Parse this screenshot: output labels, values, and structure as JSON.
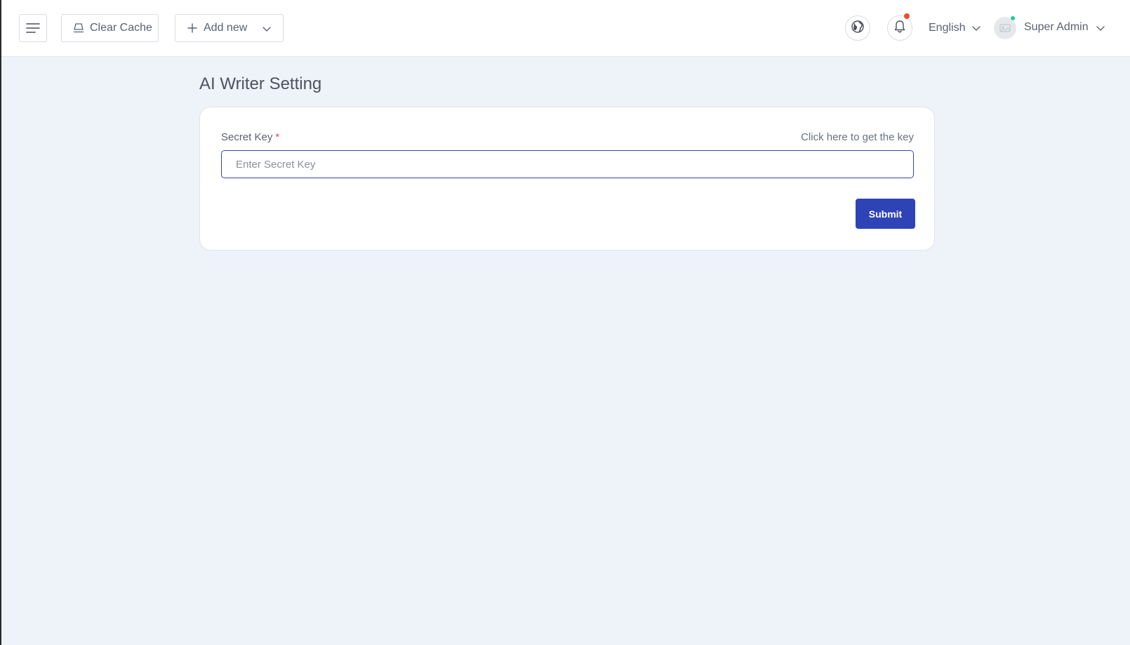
{
  "header": {
    "clear_cache_label": "Clear Cache",
    "add_new_label": "Add new",
    "language_label": "English",
    "user_name": "Super Admin",
    "icons": {
      "menu": "hamburger-menu-icon",
      "clear_cache": "broom-icon",
      "add": "plus-icon",
      "globe": "globe-icon",
      "notifications": "bell-icon",
      "dropdown": "chevron-down-icon",
      "avatar": "user-avatar-icon"
    },
    "notification_dot_color": "#f04b2f",
    "online_dot_color": "#22c79b"
  },
  "main": {
    "page_title": "AI Writer Setting",
    "form": {
      "secret_key_label": "Secret Key",
      "required_marker": "*",
      "help_link_label": "Click here to get the key",
      "secret_key_value": "",
      "secret_key_placeholder": "Enter Secret Key",
      "submit_label": "Submit"
    }
  },
  "colors": {
    "accent": "#2e44b6",
    "background": "#eef2f9",
    "required": "#e5484d"
  }
}
